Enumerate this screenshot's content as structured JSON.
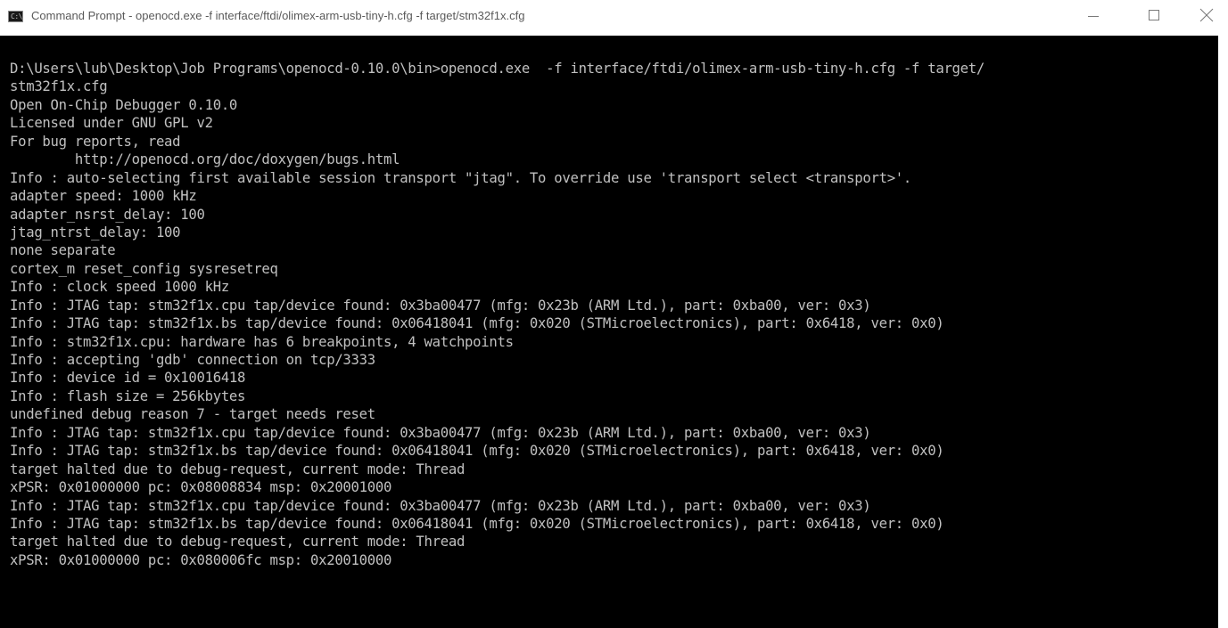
{
  "window": {
    "title": "Command Prompt - openocd.exe  -f interface/ftdi/olimex-arm-usb-tiny-h.cfg -f target/stm32f1x.cfg",
    "icon": "command-prompt-icon",
    "icon_glyph": "C:\\."
  },
  "controls": {
    "minimize": "minimize-icon",
    "maximize": "maximize-icon",
    "close": "close-icon"
  },
  "colors": {
    "console_background": "#000000",
    "console_text": "#c0c0c0",
    "titlebar_background": "#ffffff"
  },
  "console": {
    "lines": [
      "D:\\Users\\lub\\Desktop\\Job Programs\\openocd-0.10.0\\bin>openocd.exe  -f interface/ftdi/olimex-arm-usb-tiny-h.cfg -f target/",
      "stm32f1x.cfg",
      "Open On-Chip Debugger 0.10.0",
      "Licensed under GNU GPL v2",
      "For bug reports, read",
      "        http://openocd.org/doc/doxygen/bugs.html",
      "Info : auto-selecting first available session transport \"jtag\". To override use 'transport select <transport>'.",
      "adapter speed: 1000 kHz",
      "adapter_nsrst_delay: 100",
      "jtag_ntrst_delay: 100",
      "none separate",
      "cortex_m reset_config sysresetreq",
      "Info : clock speed 1000 kHz",
      "Info : JTAG tap: stm32f1x.cpu tap/device found: 0x3ba00477 (mfg: 0x23b (ARM Ltd.), part: 0xba00, ver: 0x3)",
      "Info : JTAG tap: stm32f1x.bs tap/device found: 0x06418041 (mfg: 0x020 (STMicroelectronics), part: 0x6418, ver: 0x0)",
      "Info : stm32f1x.cpu: hardware has 6 breakpoints, 4 watchpoints",
      "Info : accepting 'gdb' connection on tcp/3333",
      "Info : device id = 0x10016418",
      "Info : flash size = 256kbytes",
      "undefined debug reason 7 - target needs reset",
      "Info : JTAG tap: stm32f1x.cpu tap/device found: 0x3ba00477 (mfg: 0x23b (ARM Ltd.), part: 0xba00, ver: 0x3)",
      "Info : JTAG tap: stm32f1x.bs tap/device found: 0x06418041 (mfg: 0x020 (STMicroelectronics), part: 0x6418, ver: 0x0)",
      "target halted due to debug-request, current mode: Thread",
      "xPSR: 0x01000000 pc: 0x08008834 msp: 0x20001000",
      "Info : JTAG tap: stm32f1x.cpu tap/device found: 0x3ba00477 (mfg: 0x23b (ARM Ltd.), part: 0xba00, ver: 0x3)",
      "Info : JTAG tap: stm32f1x.bs tap/device found: 0x06418041 (mfg: 0x020 (STMicroelectronics), part: 0x6418, ver: 0x0)",
      "target halted due to debug-request, current mode: Thread",
      "xPSR: 0x01000000 pc: 0x080006fc msp: 0x20010000"
    ]
  }
}
